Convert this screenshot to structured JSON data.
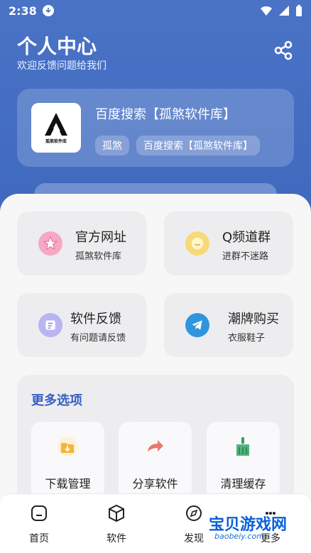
{
  "status": {
    "time": "2:38"
  },
  "header": {
    "title": "个人中心",
    "subtitle": "欢迎反馈问题给我们"
  },
  "profile": {
    "name": "百度搜索【孤煞软件库】",
    "avatar_text": "孤煞软件库",
    "tags": [
      "孤煞",
      "百度搜索【孤煞软件库】"
    ]
  },
  "actions": [
    {
      "title": "官方网址",
      "subtitle": "孤煞软件库",
      "icon": "star-icon",
      "color": "#f58cb2"
    },
    {
      "title": "Q频道群",
      "subtitle": "进群不迷路",
      "icon": "chat-icon",
      "color": "#f6d567"
    },
    {
      "title": "软件反馈",
      "subtitle": "有问题请反馈",
      "icon": "feedback-icon",
      "color": "#a9a3ef"
    },
    {
      "title": "潮牌购买",
      "subtitle": "衣服鞋子",
      "icon": "telegram-icon",
      "color": "#2f95de"
    }
  ],
  "more": {
    "title": "更多选项",
    "items": [
      {
        "label": "下载管理",
        "icon": "download-folder-icon"
      },
      {
        "label": "分享软件",
        "icon": "share-arrow-icon"
      },
      {
        "label": "清理缓存",
        "icon": "broom-icon"
      }
    ]
  },
  "nav": [
    {
      "label": "首页",
      "icon": "home-icon"
    },
    {
      "label": "软件",
      "icon": "cube-icon"
    },
    {
      "label": "发现",
      "icon": "discover-icon"
    },
    {
      "label": "更多",
      "icon": "more-icon"
    }
  ],
  "watermark": {
    "text": "宝贝游戏网",
    "url": "baobeiy.com"
  }
}
